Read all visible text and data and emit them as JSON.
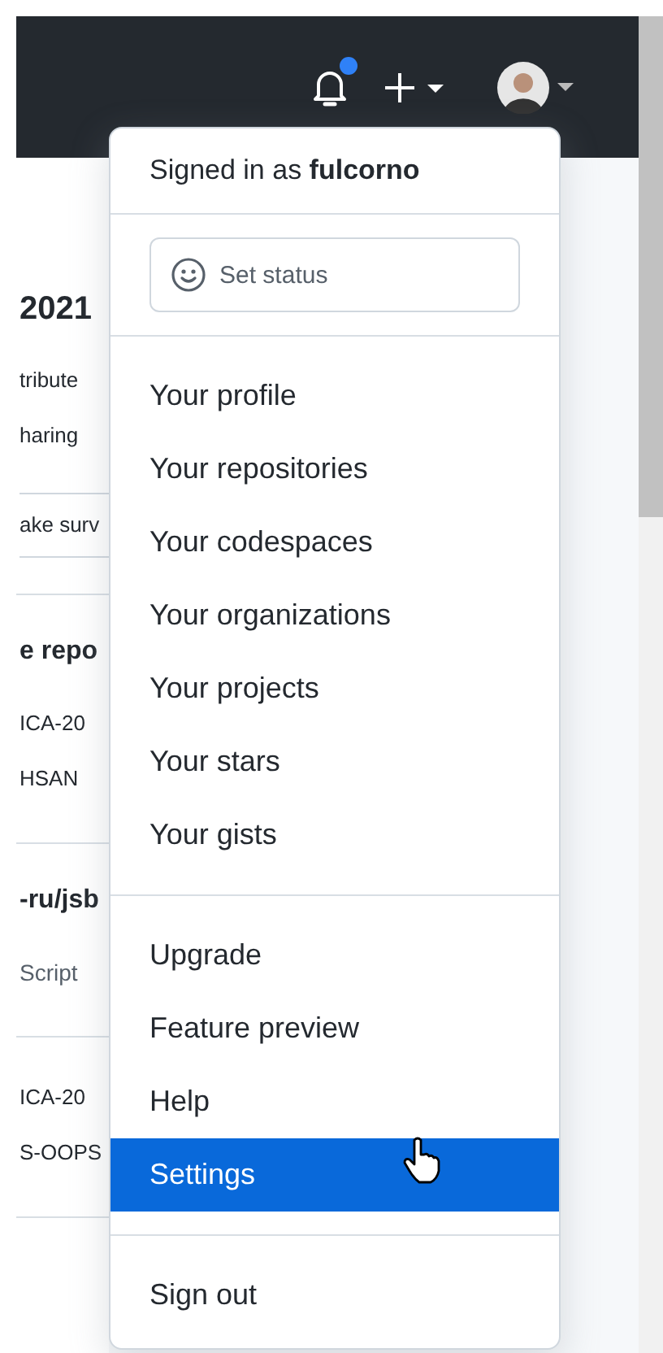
{
  "header": {
    "notifications_unread": true
  },
  "background": {
    "sections": [
      {
        "items": [
          {
            "kind": "heading",
            "text": "2021"
          },
          {
            "kind": "text",
            "text": "tribute"
          },
          {
            "kind": "text",
            "text": "haring"
          },
          {
            "kind": "button",
            "text": "ake surv"
          }
        ]
      },
      {
        "items": [
          {
            "kind": "heading",
            "text": "e repo"
          },
          {
            "kind": "text",
            "text": "ICA-20"
          },
          {
            "kind": "text",
            "text": "HSAN"
          }
        ]
      },
      {
        "items": [
          {
            "kind": "heading",
            "text": "-ru/jsb"
          },
          {
            "kind": "muted",
            "text": "Script"
          }
        ]
      },
      {
        "items": [
          {
            "kind": "text",
            "text": "ICA-20"
          },
          {
            "kind": "text",
            "text": "S-OOPS"
          }
        ]
      }
    ]
  },
  "menu": {
    "signed_in_prefix": "Signed in as ",
    "username": "fulcorno",
    "set_status": "Set status",
    "groups": [
      [
        {
          "label": "Your profile",
          "selected": false
        },
        {
          "label": "Your repositories",
          "selected": false
        },
        {
          "label": "Your codespaces",
          "selected": false
        },
        {
          "label": "Your organizations",
          "selected": false
        },
        {
          "label": "Your projects",
          "selected": false
        },
        {
          "label": "Your stars",
          "selected": false
        },
        {
          "label": "Your gists",
          "selected": false
        }
      ],
      [
        {
          "label": "Upgrade",
          "selected": false
        },
        {
          "label": "Feature preview",
          "selected": false
        },
        {
          "label": "Help",
          "selected": false
        },
        {
          "label": "Settings",
          "selected": true
        }
      ],
      [
        {
          "label": "Sign out",
          "selected": false
        }
      ]
    ]
  }
}
